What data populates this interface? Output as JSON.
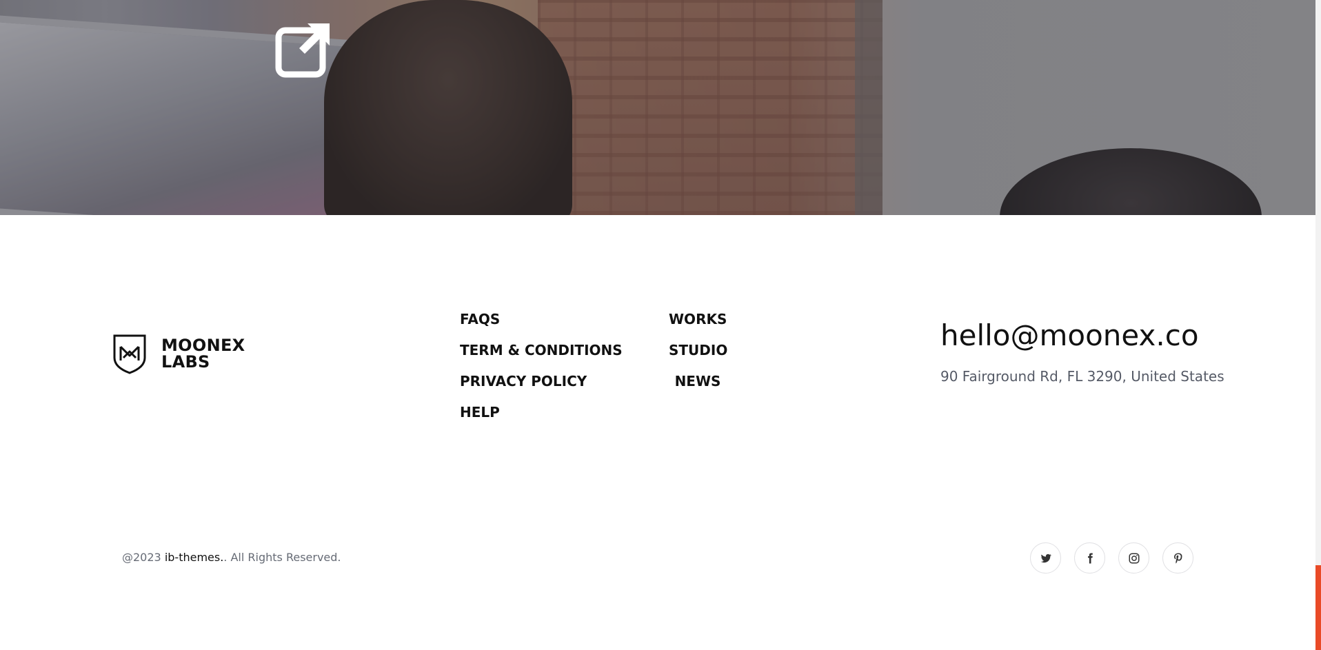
{
  "hero": {
    "image_description_icon": "external-link-icon"
  },
  "logo": {
    "line1": "MOONEX",
    "line2": "LABS",
    "icon": "shield-m-logo-icon"
  },
  "footer_nav": {
    "col1": [
      "FAQS",
      "TERM & CONDITIONS",
      "PRIVACY POLICY",
      "HELP"
    ],
    "col2": [
      "WORKS",
      "STUDIO",
      "NEWS"
    ]
  },
  "contact": {
    "email": "hello@moonex.co",
    "address": "90 Fairground Rd, FL 3290, United States"
  },
  "copyright": {
    "prefix": "@2023 ",
    "brand": "ib-themes.",
    "suffix": ". All Rights Reserved."
  },
  "social": [
    "twitter-icon",
    "facebook-icon",
    "instagram-icon",
    "pinterest-icon"
  ],
  "colors": {
    "accent": "#e94a27",
    "text": "#111111",
    "muted": "#555a66"
  }
}
